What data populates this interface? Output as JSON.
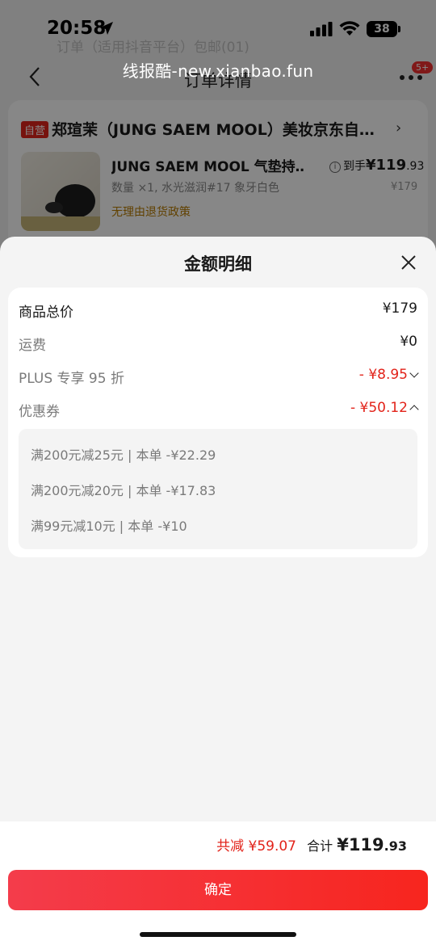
{
  "status_bar": {
    "time": "20:58",
    "battery": "38"
  },
  "background": {
    "watermark": "线报酷-new.xianbao.fun",
    "faded_text": "订单（适用抖音平台）包邮(01)",
    "nav_title": "订单详情",
    "badge": "5+",
    "store": {
      "tag": "自营",
      "name": "郑瑄茉（JUNG SAEM MOOL）美妆京东自…",
      "product_name": "JUNG SAEM MOOL 气垫持…",
      "price_prefix": "到手",
      "price_main": "¥119",
      "price_decimal": ".93",
      "spec": "数量 ×1, 水光滋润#17 象牙白色",
      "original_price": "¥179",
      "policy": "无理由退货政策"
    }
  },
  "sheet": {
    "title": "金额明细",
    "rows": {
      "goods_total": {
        "label": "商品总价",
        "value": "¥179"
      },
      "shipping": {
        "label": "运费",
        "value": "¥0"
      },
      "plus": {
        "label": "PLUS 专享 95 折",
        "value": "- ¥8.95"
      },
      "coupon": {
        "label": "优惠券",
        "value": "- ¥50.12"
      }
    },
    "coupons": [
      "满200元减25元 | 本单 -¥22.29",
      "满200元减20元 | 本单 -¥17.83",
      "满99元减10元 | 本单 -¥10"
    ]
  },
  "footer": {
    "total_savings": "共减 ¥59.07",
    "total_label": "合计",
    "total_main": "¥119",
    "total_decimal": ".93",
    "confirm_label": "确定"
  },
  "colors": {
    "accent_red": "#e2231a",
    "button_gradient_start": "#f43c4b",
    "button_gradient_end": "#f7251e"
  }
}
